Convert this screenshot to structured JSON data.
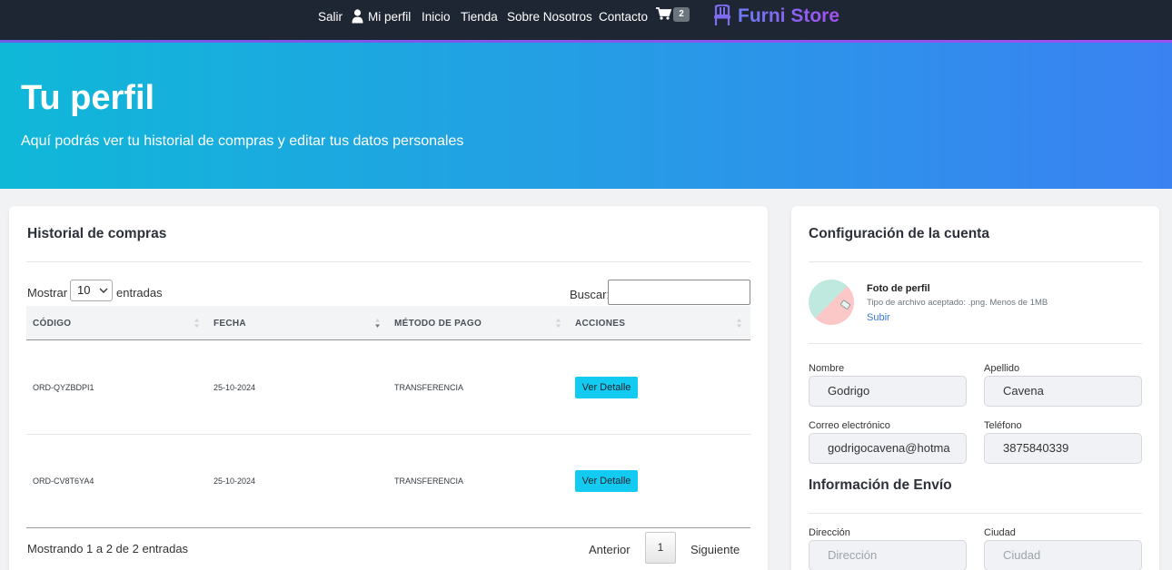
{
  "nav": {
    "links": [
      "Salir",
      "Mi perfil",
      "Inicio",
      "Tienda",
      "Sobre Nosotros",
      "Contacto"
    ],
    "cart_count": "2",
    "brand": "Furni Store",
    "icons": {
      "user": "user-icon",
      "cart": "cart-icon",
      "brand": "chair-icon"
    },
    "colors": {
      "bar": "#1f2633",
      "brand": "#8a63ef"
    }
  },
  "hero": {
    "title": "Tu perfil",
    "subtitle": "Aquí podrás ver tu historial de compras y editar tus datos personales"
  },
  "history": {
    "title": "Historial de compras",
    "show_label": "Mostrar",
    "page_size": "10",
    "entries_label": "entradas",
    "search_label": "Buscar:",
    "columns": [
      "CÓDIGO",
      "FECHA",
      "MÉTODO DE PAGO",
      "ACCIONES"
    ],
    "rows": [
      {
        "code": "ORD-QYZBDPI1",
        "date": "25-10-2024",
        "method": "TRANSFERENCIA",
        "action": "Ver Detalle"
      },
      {
        "code": "ORD-CV8T6YA4",
        "date": "25-10-2024",
        "method": "TRANSFERENCIA",
        "action": "Ver Detalle"
      }
    ],
    "summary": "Mostrando 1 a 2 de 2 entradas",
    "pagination": {
      "prev": "Anterior",
      "page": "1",
      "next": "Siguiente"
    }
  },
  "account": {
    "title": "Configuración de la cuenta",
    "photo_title": "Foto de perfil",
    "photo_hint": "Tipo de archivo aceptado: .png. Menos de 1MB",
    "upload_label": "Subir",
    "fields": {
      "first_name": {
        "label": "Nombre",
        "value": "Godrigo"
      },
      "last_name": {
        "label": "Apellido",
        "value": "Cavena"
      },
      "email": {
        "label": "Correo electrónico",
        "value": "godrigocavena@hotma"
      },
      "phone": {
        "label": "Teléfono",
        "value": "3875840339"
      }
    },
    "shipping_title": "Información de Envío",
    "shipping": {
      "address": {
        "label": "Dirección",
        "placeholder": "Dirección"
      },
      "city": {
        "label": "Ciudad",
        "placeholder": "Ciudad"
      }
    }
  }
}
